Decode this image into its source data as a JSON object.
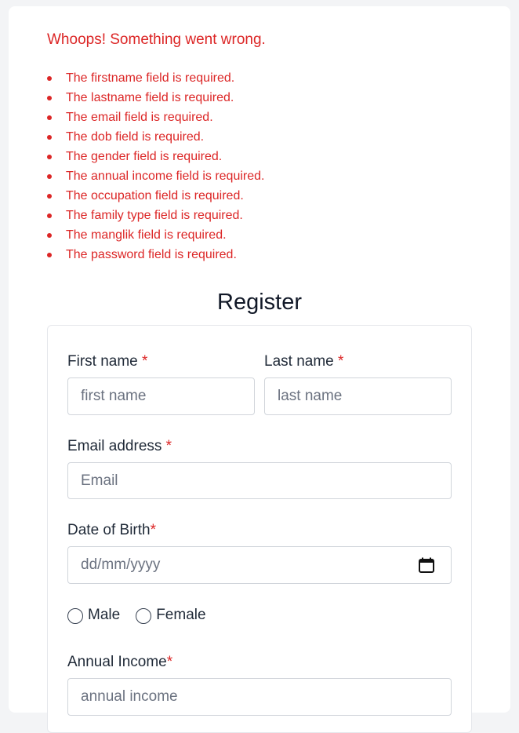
{
  "errors": {
    "title": "Whoops! Something went wrong.",
    "items": [
      "The firstname field is required.",
      "The lastname field is required.",
      "The email field is required.",
      "The dob field is required.",
      "The gender field is required.",
      "The annual income field is required.",
      "The occupation field is required.",
      "The family type field is required.",
      "The manglik field is required.",
      "The password field is required."
    ]
  },
  "form": {
    "title": "Register",
    "required_mark": "*",
    "first_name": {
      "label": "First name",
      "placeholder": "first name"
    },
    "last_name": {
      "label": "Last name",
      "placeholder": "last name"
    },
    "email": {
      "label": "Email address",
      "placeholder": "Email"
    },
    "dob": {
      "label": "Date of Birth",
      "placeholder": "dd/mm/yyyy"
    },
    "gender": {
      "options": [
        "Male",
        "Female"
      ]
    },
    "annual_income": {
      "label": "Annual Income",
      "placeholder": "annual income"
    }
  },
  "colors": {
    "error": "#dc2626",
    "background": "#f3f4f6",
    "card": "#ffffff"
  },
  "icons": {
    "date_picker": "calendar-icon"
  }
}
